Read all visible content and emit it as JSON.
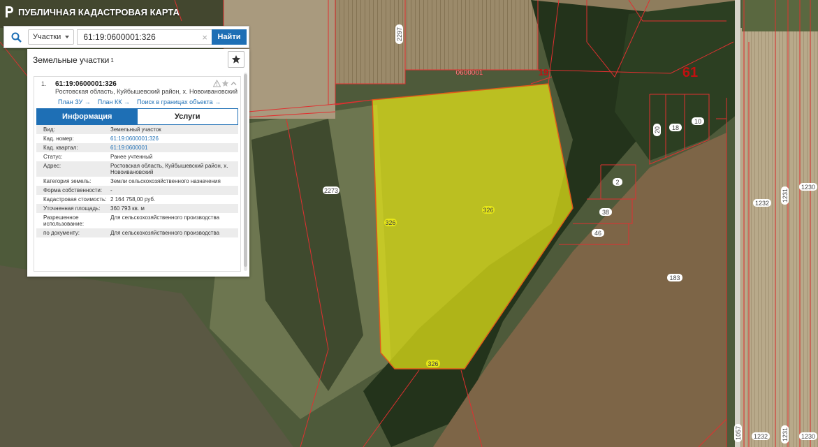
{
  "app": {
    "title": "ПУБЛИЧНАЯ КАДАСТРОВАЯ КАРТА"
  },
  "search": {
    "type_label": "Участки",
    "query": "61:19:0600001:326",
    "button_label": "Найти"
  },
  "panel": {
    "title": "Земельные участки",
    "count": "1",
    "result": {
      "index": "1.",
      "cad_number": "61:19:0600001:326",
      "address": "Ростовская область, Куйбышевский район, х. Новоивановский",
      "links": [
        "План ЗУ →",
        "План КК →",
        "Поиск в границах объекта →"
      ]
    },
    "tabs": [
      {
        "label": "Информация",
        "active": true
      },
      {
        "label": "Услуги",
        "active": false
      }
    ],
    "properties": [
      {
        "key": "Вид:",
        "value": "Земельный участок"
      },
      {
        "key": "Кад. номер:",
        "value": "61:19:0600001:326"
      },
      {
        "key": "Кад. квартал:",
        "value": "61:19:0600001"
      },
      {
        "key": "Статус:",
        "value": "Ранее учтенный"
      },
      {
        "key": "Адрес:",
        "value": "Ростовская область, Куйбышевский район, х. Новоивановский"
      },
      {
        "key": "Категория земель:",
        "value": "Земли сельскохозяйственного назначения"
      },
      {
        "key": "Форма собственности:",
        "value": "-"
      },
      {
        "key": "Кадастровая стоимость:",
        "value": "2 164 758,00 руб."
      },
      {
        "key": "Уточненная площадь:",
        "value": "360 793 кв. м"
      },
      {
        "key": "Разрешенное использование:",
        "value": "Для сельскохозяйственного производства"
      },
      {
        "key": "по документу:",
        "value": "Для сельскохозяйственного производства"
      }
    ]
  },
  "map": {
    "parcel_labels": [
      "326",
      "326",
      "326",
      "2273",
      "2297",
      "0600001",
      "19",
      "61",
      "20",
      "18",
      "10",
      "2",
      "38",
      "46",
      "183",
      "1232",
      "1231",
      "1230",
      "1057",
      "1232",
      "1231",
      "1230"
    ],
    "colors": {
      "boundary": "#e03030",
      "selected_fill": "#e6e617",
      "selected_stroke": "#e05a1a",
      "accent": "#1e6fb5"
    }
  }
}
